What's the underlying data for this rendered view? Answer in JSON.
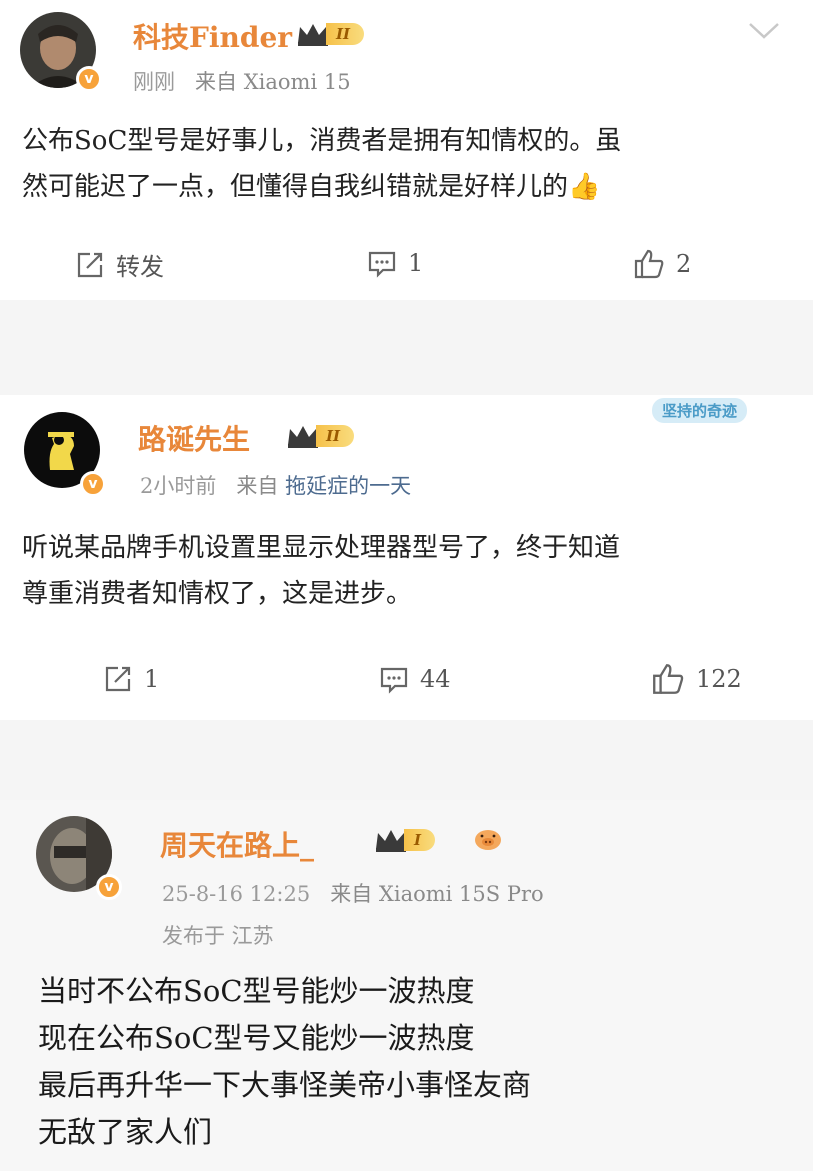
{
  "posts": [
    {
      "username": "科技Finder",
      "vip_level": "II",
      "time": "刚刚",
      "source_prefix": "来自",
      "source": "Xiaomi 15",
      "content_lines": [
        "公布SoC型号是好事儿，消费者是拥有知情权的。虽",
        "然可能迟了一点，但懂得自我纠错就是好样儿的👍"
      ],
      "repost_label": "转发",
      "comments": "1",
      "likes": "2"
    },
    {
      "username": "路诞先生",
      "vip_level": "II",
      "time": "2小时前",
      "source_prefix": "来自",
      "source": "拖延症的一天",
      "tag": "坚持的奇迹",
      "content_lines": [
        "听说某品牌手机设置里显示处理器型号了，终于知道",
        "尊重消费者知情权了，这是进步。"
      ],
      "reposts": "1",
      "comments": "44",
      "likes": "122"
    },
    {
      "username": "周天在路上_",
      "vip_level": "I",
      "time": "25-8-16 12:25",
      "source_prefix": "来自",
      "source": "Xiaomi 15S Pro",
      "location": "发布于 江苏",
      "content_lines": [
        "当时不公布SoC型号能炒一波热度",
        "现在公布SoC型号又能炒一波热度",
        "最后再升华一下大事怪美帝小事怪友商",
        "无敌了家人们"
      ]
    }
  ],
  "icons": {
    "repost": "repost-icon",
    "comment": "comment-icon",
    "like": "like-icon",
    "more": "chevron-down-icon",
    "verified": "verified-badge-icon",
    "vip": "vip-crown-icon"
  },
  "colors": {
    "username": "#e8873a",
    "meta": "#9a9a9a",
    "vip_gold": "#f6c14a",
    "verified": "#f7a23a"
  }
}
